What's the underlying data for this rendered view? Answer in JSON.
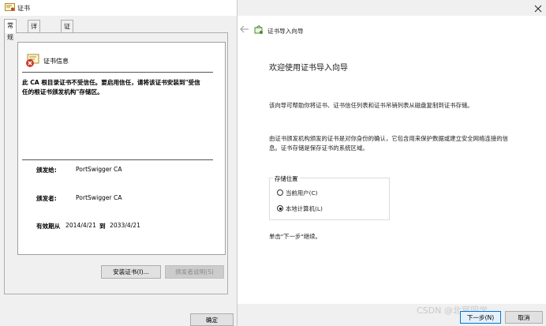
{
  "cert_window": {
    "title": "证书",
    "tabs": [
      {
        "label": "常规"
      },
      {
        "label": "详细信息"
      },
      {
        "label": "证书路径"
      }
    ],
    "info_heading": "证书信息",
    "warning_line1": "此 CA 根目录证书不受信任。要启用信任，请将该证书安装到\"受信",
    "warning_line2": "任的根证书颁发机构\"存储区。",
    "issued_to_label": "颁发给:",
    "issued_to_value": "PortSwigger CA",
    "issued_by_label": "颁发者:",
    "issued_by_value": "PortSwigger CA",
    "valid_label": "有效期从",
    "valid_from": "2014/4/21",
    "valid_to_word": "到",
    "valid_to": "2033/4/21",
    "install_button": "安装证书(I)...",
    "statement_button": "颁发者说明(S)",
    "ok_button": "确定"
  },
  "wizard": {
    "title": "证书导入向导",
    "heading": "欢迎使用证书导入向导",
    "desc1": "该向导可帮助你将证书、证书信任列表和证书吊销列表从磁盘复制到证书存储。",
    "desc2_line1": "由证书颁发机构颁发的证书是对你身份的确认，它包含用来保护数据或建立安全网络连接的信",
    "desc2_line2": "息。证书存储是保存证书的系统区域。",
    "store_legend": "存储位置",
    "options": [
      {
        "label": "当前用户(C)",
        "checked": false
      },
      {
        "label": "本地计算机(L)",
        "checked": true
      }
    ],
    "continue_text": "单击\"下一步\"继续。",
    "next_button": "下一步(N)",
    "cancel_button": "取消"
  },
  "watermark": "CSDN @北冥同学"
}
